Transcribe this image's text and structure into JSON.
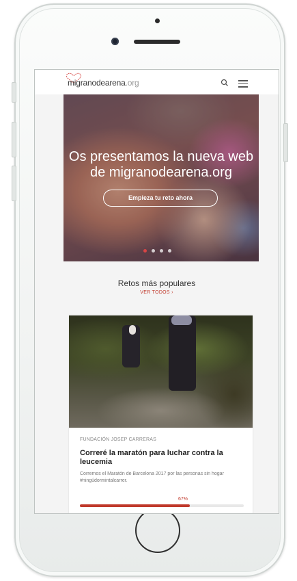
{
  "app": {
    "logo_main": "migranodearena",
    "logo_suffix": ".org",
    "brand_color": "#c0392b"
  },
  "header": {
    "search_icon": "search-icon",
    "menu_icon": "hamburger-menu-icon"
  },
  "hero": {
    "title_line1": "Os presentamos la nueva web",
    "title_line2": "de migranodearena.org",
    "cta_label": "Empieza tu reto ahora",
    "slides_count": 4,
    "active_slide": 1
  },
  "popular": {
    "title": "Retos más populares",
    "view_all": "VER TODOS ›"
  },
  "card": {
    "organization": "FUNDACIÓN JOSEP CARRERAS",
    "title": "Correré la maratón para luchar contra la leucemia",
    "description": "Corremos el Maratón de Barcelona 2017 por las personas sin hogar #ningúdormintalcarrer.",
    "progress_label": "67%",
    "progress_value": 0.67
  }
}
